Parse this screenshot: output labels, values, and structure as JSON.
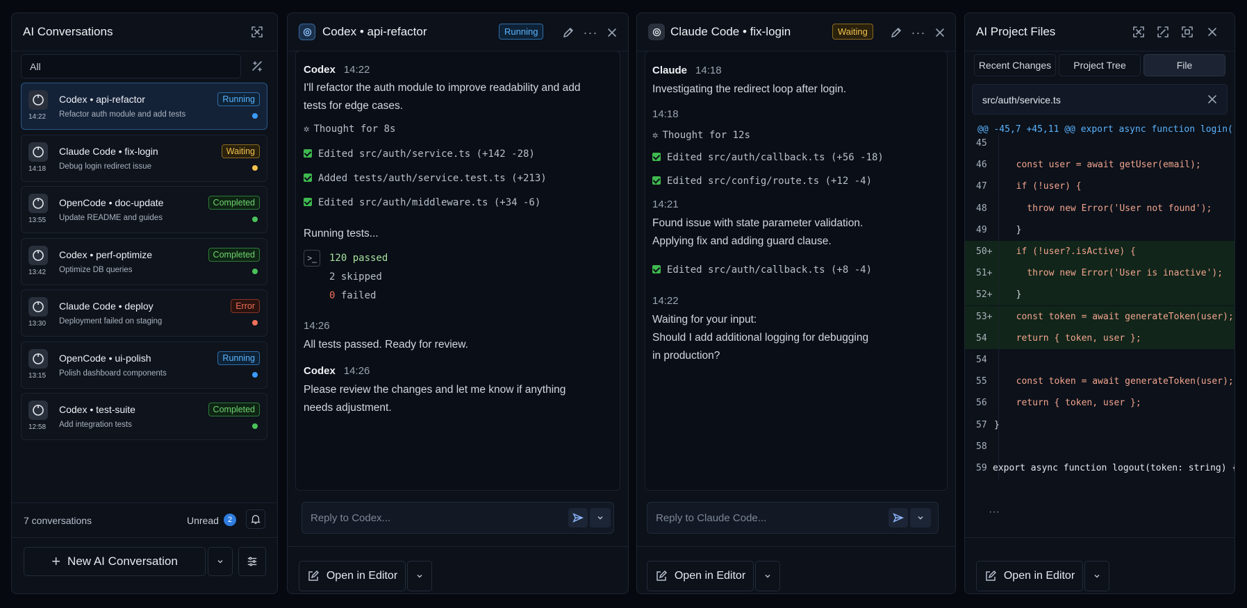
{
  "sidebar": {
    "title": "AI Conversations",
    "filter": "All",
    "conversations": [
      {
        "title": "Codex • api-refactor",
        "subtitle": "Refactor auth module and add tests",
        "time": "14:22",
        "status": "Running",
        "status_kind": "run",
        "active": true
      },
      {
        "title": "Claude Code • fix-login",
        "subtitle": "Debug login redirect issue",
        "time": "14:18",
        "status": "Waiting",
        "status_kind": "wait"
      },
      {
        "title": "OpenCode • doc-update",
        "subtitle": "Update README and guides",
        "time": "13:55",
        "status": "Completed",
        "status_kind": "done"
      },
      {
        "title": "Codex • perf-optimize",
        "subtitle": "Optimize DB queries",
        "time": "13:42",
        "status": "Completed",
        "status_kind": "done"
      },
      {
        "title": "Claude Code • deploy",
        "subtitle": "Deployment failed on staging",
        "time": "13:30",
        "status": "Error",
        "status_kind": "err"
      },
      {
        "title": "OpenCode • ui-polish",
        "subtitle": "Polish dashboard components",
        "time": "13:15",
        "status": "Running",
        "status_kind": "run"
      },
      {
        "title": "Codex • test-suite",
        "subtitle": "Add integration tests",
        "time": "12:58",
        "status": "Completed",
        "status_kind": "done"
      }
    ],
    "count_label": "7 conversations",
    "unread_label": "Unread",
    "unread_count": "2",
    "new_button": "New AI Conversation"
  },
  "codex": {
    "title": "Codex • api-refactor",
    "status": "Running",
    "author": "Codex",
    "time1": "14:22",
    "msg1": "I'll refactor the auth module to improve readability and add",
    "msg1b": "tests for edge cases.",
    "thought": "Thought for 8s",
    "edits": [
      "Edited src/auth/service.ts (+142 -28)",
      "Added tests/auth/service.test.ts (+213)",
      "Edited src/auth/middleware.ts (+34 -6)"
    ],
    "running": "Running tests...",
    "passed": "120 passed",
    "skipped": "2 skipped",
    "failed_n": "0",
    "failed": "failed",
    "time2": "14:26",
    "msg2": "All tests passed. Ready for review.",
    "time3": "14:26",
    "msg3": "Please review the changes and let me know if anything",
    "msg3b": "needs adjustment.",
    "reply_placeholder": "Reply to Codex...",
    "open_editor": "Open in Editor"
  },
  "claude": {
    "title": "Claude Code • fix-login",
    "status": "Waiting",
    "author": "Claude",
    "time1": "14:18",
    "msg1": "Investigating the redirect loop after login.",
    "time2": "14:18",
    "thought": "Thought for 12s",
    "edits": [
      "Edited src/auth/callback.ts (+56 -18)",
      "Edited src/config/route.ts (+12 -4)"
    ],
    "time3": "14:21",
    "msg2": "Found issue with state parameter validation.",
    "msg2b": "Applying fix and adding guard clause.",
    "edit3": "Edited src/auth/callback.ts (+8 -4)",
    "time4": "14:22",
    "msg3": "Waiting for your input:",
    "msg3b": "Should I add additional logging for debugging",
    "msg3c": "in production?",
    "reply_placeholder": "Reply to Claude Code...",
    "open_editor": "Open in Editor"
  },
  "files": {
    "title": "AI Project Files",
    "tabs": [
      "Recent Changes",
      "Project Tree",
      "File"
    ],
    "path": "src/auth/service.ts",
    "hunk": "@@ -45,7 +45,11 @@ export async function login(",
    "lines": [
      {
        "n": "45",
        "code": "",
        "add": false
      },
      {
        "n": "46",
        "code": "  const user = await getUser(email);",
        "add": false
      },
      {
        "n": "47",
        "code": "  if (!user) {",
        "add": false
      },
      {
        "n": "48",
        "code": "    throw new Error('User not found');",
        "add": false
      },
      {
        "n": "49",
        "code": "  }",
        "add": false
      },
      {
        "n": "50+",
        "code": "  if (!user?.isActive) {",
        "add": true
      },
      {
        "n": "51+",
        "code": "    throw new Error('User is inactive');",
        "add": true
      },
      {
        "n": "52+",
        "code": "  }",
        "add": true
      },
      {
        "n": "53+",
        "code": "  const token = await generateToken(user);",
        "add": true
      },
      {
        "n": "54",
        "code": "  return { token, user };",
        "add": true
      },
      {
        "n": "54",
        "code": "",
        "add": false
      },
      {
        "n": "55",
        "code": "  const token = await generateToken(user);",
        "add": false
      },
      {
        "n": "56",
        "code": "  return { token, user };",
        "add": false
      },
      {
        "n": "57",
        "code": "}",
        "add": false
      },
      {
        "n": "58",
        "code": "",
        "add": false
      },
      {
        "n": "59",
        "code": "export async function logout(token: string) {",
        "add": false
      }
    ],
    "more": "···",
    "open_editor": "Open in Editor"
  }
}
